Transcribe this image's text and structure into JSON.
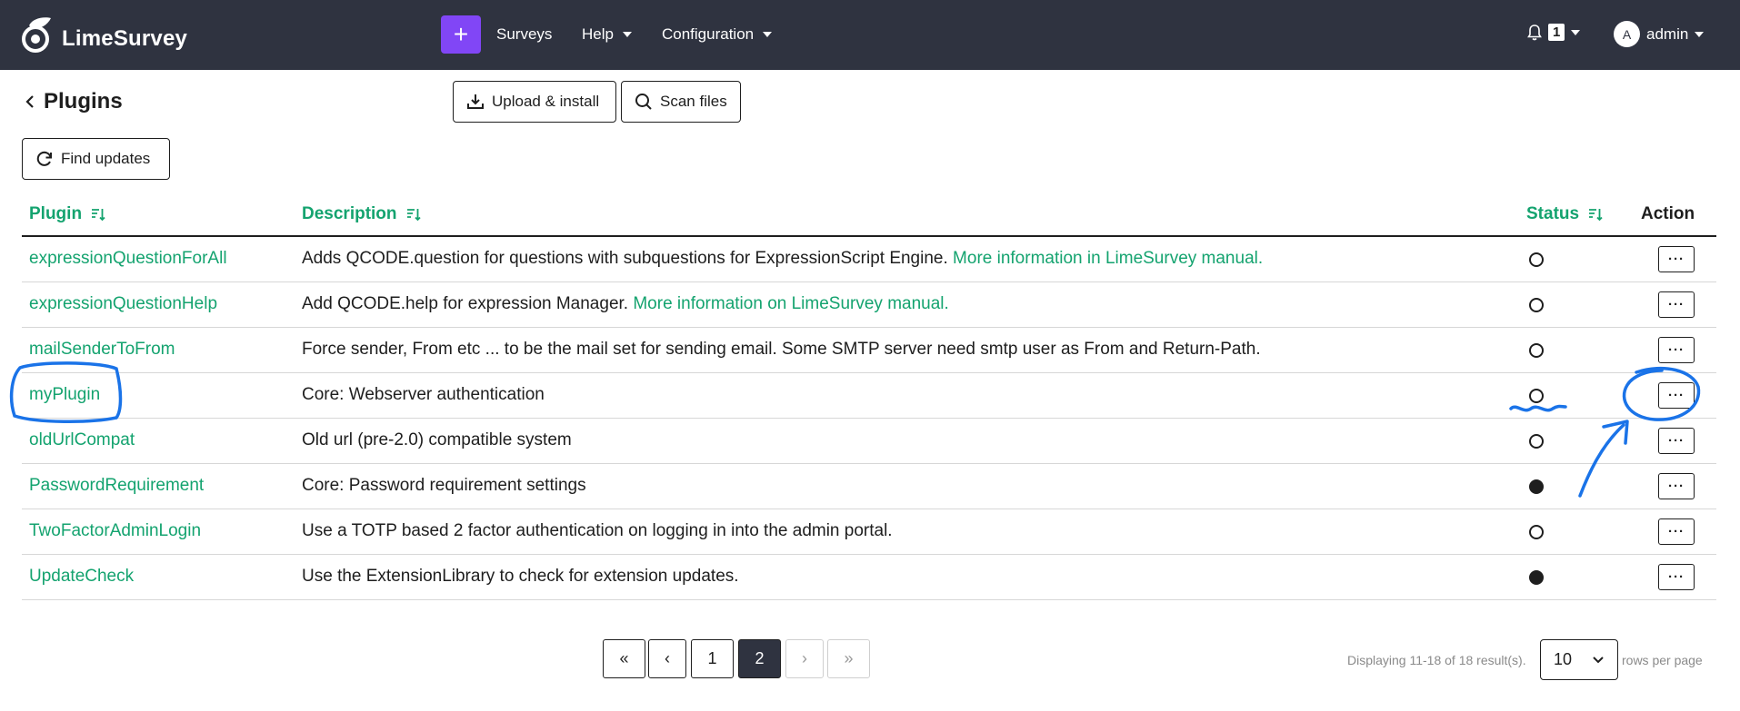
{
  "navbar": {
    "brand": "LimeSurvey",
    "plus_label": "+",
    "links": [
      {
        "label": "Surveys"
      },
      {
        "label": "Help"
      },
      {
        "label": "Configuration"
      }
    ],
    "notification_count": "1",
    "user_initial": "A",
    "user_name": "admin",
    "bg_color": "#2f3340",
    "accent_color": "#8146f6"
  },
  "header": {
    "title": "Plugins",
    "upload_label": "Upload & install",
    "scan_label": "Scan files",
    "find_updates_label": "Find updates"
  },
  "table": {
    "columns": {
      "plugin": "Plugin",
      "description": "Description",
      "status": "Status",
      "action": "Action"
    },
    "rows": [
      {
        "name": "expressionQuestionForAll",
        "description": "Adds QCODE.question for questions with subquestions for ExpressionScript Engine.",
        "link": "More information in LimeSurvey manual.",
        "status": "inactive"
      },
      {
        "name": "expressionQuestionHelp",
        "description": "Add QCODE.help for expression Manager.",
        "link": "More information on LimeSurvey manual.",
        "status": "inactive"
      },
      {
        "name": "mailSenderToFrom",
        "description": "Force sender, From etc ... to be the mail set for sending email. Some SMTP server need smtp user as From and Return-Path.",
        "link": "",
        "status": "inactive"
      },
      {
        "name": "myPlugin",
        "description": "Core: Webserver authentication",
        "link": "",
        "status": "inactive"
      },
      {
        "name": "oldUrlCompat",
        "description": "Old url (pre-2.0) compatible system",
        "link": "",
        "status": "inactive"
      },
      {
        "name": "PasswordRequirement",
        "description": "Core: Password requirement settings",
        "link": "",
        "status": "active"
      },
      {
        "name": "TwoFactorAdminLogin",
        "description": "Use a TOTP based 2 factor authentication on logging in into the admin portal.",
        "link": "",
        "status": "inactive"
      },
      {
        "name": "UpdateCheck",
        "description": "Use the ExtensionLibrary to check for extension updates.",
        "link": "",
        "status": "active"
      }
    ],
    "action_label": "···",
    "link_color": "#14a36f"
  },
  "pagination": {
    "first": "«",
    "prev": "‹",
    "pages": [
      "1",
      "2"
    ],
    "current": "2",
    "next": "›",
    "last": "»",
    "summary": "Displaying 11-18 of 18 result(s).",
    "rows_per_page_value": "10",
    "rows_per_page_label": "rows per page"
  },
  "annotations": {
    "color": "#1a73e8",
    "marks": [
      "circle around myPlugin",
      "wavy underline under status",
      "arrow to action button",
      "circle around action button"
    ]
  }
}
